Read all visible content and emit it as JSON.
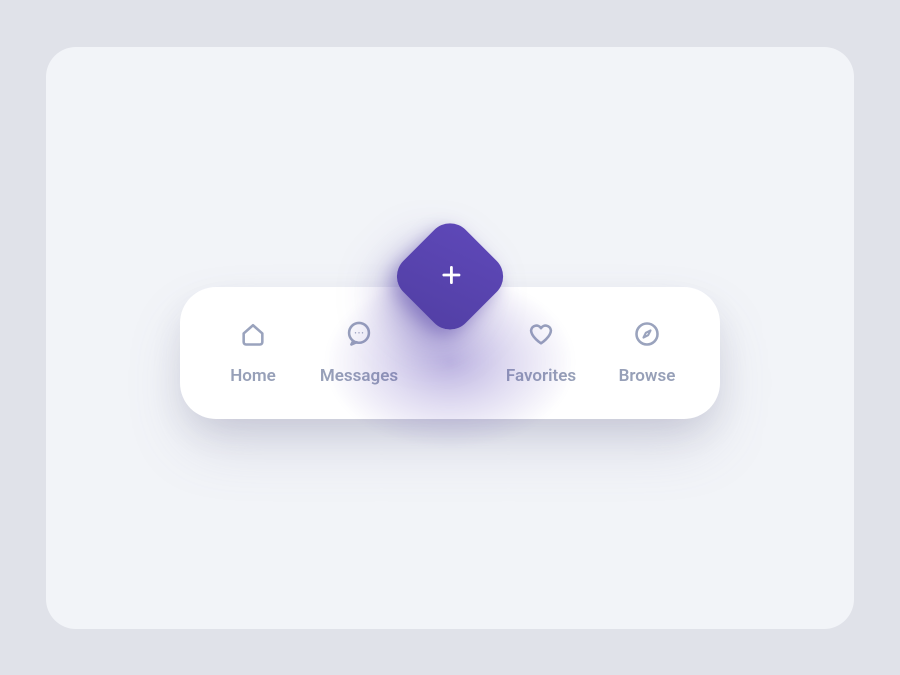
{
  "colors": {
    "page_bg": "#e0e2e9",
    "card_bg": "#f2f4f8",
    "nav_bg": "#ffffff",
    "accent": "#523fa5",
    "text_muted": "#97a0b8",
    "icon": "#9aa3bd"
  },
  "nav": {
    "items": [
      {
        "label": "Home",
        "icon": "home-icon"
      },
      {
        "label": "Messages",
        "icon": "messages-icon"
      },
      {
        "label": "Favorites",
        "icon": "heart-icon"
      },
      {
        "label": "Browse",
        "icon": "compass-icon"
      }
    ],
    "fab": {
      "icon": "plus-icon"
    }
  }
}
